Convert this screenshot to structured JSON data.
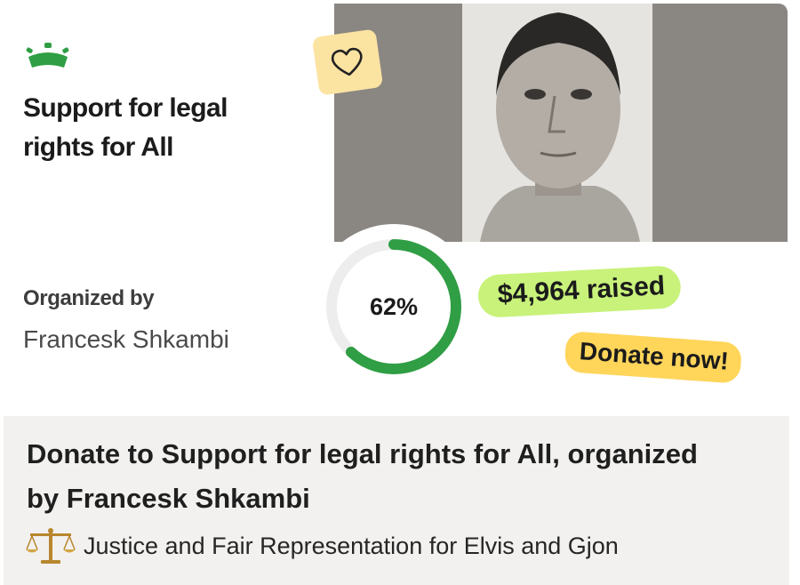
{
  "campaign": {
    "title": "Support for legal rights for All",
    "organized_by_label": "Organized by",
    "organizer": "Francesk Shkambi",
    "progress_percent": 62,
    "progress_label": "62%",
    "raised": "$4,964 raised",
    "donate_label": "Donate now!",
    "heading": "Donate to Support for legal rights for All, organized by Francesk Shkambi",
    "subtitle": "Justice and Fair Representation for Elvis and Gjon"
  },
  "icons": {
    "logo": "gofundme-logo-icon",
    "favorite": "heart-icon",
    "subtitle_icon": "balance-scales-icon"
  },
  "colors": {
    "progress": "#2f9e44",
    "progress_track": "#ededed",
    "raised_bg": "#c8f27a",
    "donate_bg": "#ffd55a",
    "heart_bg": "#fbe3a2",
    "logo": "#2f9e44"
  }
}
